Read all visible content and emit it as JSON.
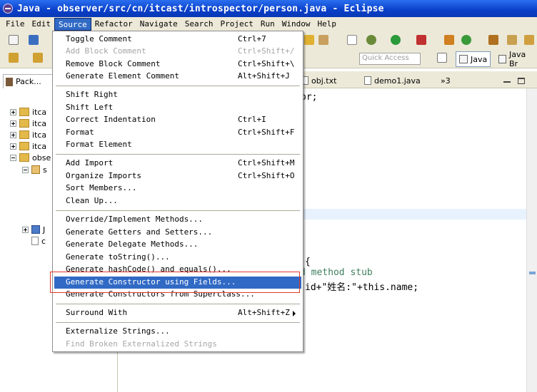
{
  "window": {
    "title": "Java - observer/src/cn/itcast/introspector/person.java - Eclipse"
  },
  "menubar": {
    "items": [
      "File",
      "Edit",
      "Source",
      "Refactor",
      "Navigate",
      "Search",
      "Project",
      "Run",
      "Window",
      "Help"
    ],
    "active": "Source"
  },
  "toolbar": {
    "quick_access_placeholder": "Quick Access",
    "perspectives": [
      "Java",
      "Java Br"
    ]
  },
  "left_panel": {
    "tab_label": "Pack...",
    "tree": [
      {
        "label": "itca",
        "expanded": false
      },
      {
        "label": "itca",
        "expanded": false
      },
      {
        "label": "itca",
        "expanded": false
      },
      {
        "label": "itca",
        "expanded": false
      },
      {
        "label": "obse",
        "expanded": true
      },
      {
        "label": "s",
        "expanded": true
      },
      {
        "label": "J",
        "expanded": false
      },
      {
        "label": "c",
        "expanded": false
      }
    ]
  },
  "editor": {
    "tabs": [
      {
        "label": "obj.txt"
      },
      {
        "label": "demo1.java"
      },
      {
        "label": "»3"
      }
    ],
    "code_lines": [
      "or;",
      "{",
      "d method stub",
      "id+\"姓名:\"+this.name;"
    ]
  },
  "source_menu": {
    "groups": [
      [
        {
          "label": "Toggle Comment",
          "shortcut": "Ctrl+7",
          "enabled": true
        },
        {
          "label": "Add Block Comment",
          "shortcut": "Ctrl+Shift+/",
          "enabled": false
        },
        {
          "label": "Remove Block Comment",
          "shortcut": "Ctrl+Shift+\\",
          "enabled": true
        },
        {
          "label": "Generate Element Comment",
          "shortcut": "Alt+Shift+J",
          "enabled": true
        }
      ],
      [
        {
          "label": "Shift Right",
          "shortcut": "",
          "enabled": true
        },
        {
          "label": "Shift Left",
          "shortcut": "",
          "enabled": true
        },
        {
          "label": "Correct Indentation",
          "shortcut": "Ctrl+I",
          "enabled": true
        },
        {
          "label": "Format",
          "shortcut": "Ctrl+Shift+F",
          "enabled": true
        },
        {
          "label": "Format Element",
          "shortcut": "",
          "enabled": true
        }
      ],
      [
        {
          "label": "Add Import",
          "shortcut": "Ctrl+Shift+M",
          "enabled": true
        },
        {
          "label": "Organize Imports",
          "shortcut": "Ctrl+Shift+O",
          "enabled": true
        },
        {
          "label": "Sort Members...",
          "shortcut": "",
          "enabled": true
        },
        {
          "label": "Clean Up...",
          "shortcut": "",
          "enabled": true
        }
      ],
      [
        {
          "label": "Override/Implement Methods...",
          "shortcut": "",
          "enabled": true
        },
        {
          "label": "Generate Getters and Setters...",
          "shortcut": "",
          "enabled": true
        },
        {
          "label": "Generate Delegate Methods...",
          "shortcut": "",
          "enabled": true
        },
        {
          "label": "Generate toString()...",
          "shortcut": "",
          "enabled": true
        },
        {
          "label": "Generate hashCode() and equals()...",
          "shortcut": "",
          "enabled": true
        },
        {
          "label": "Generate Constructor using Fields...",
          "shortcut": "",
          "enabled": true,
          "selected": true
        },
        {
          "label": "Generate Constructors from Superclass...",
          "shortcut": "",
          "enabled": true
        }
      ],
      [
        {
          "label": "Surround With",
          "shortcut": "Alt+Shift+Z",
          "enabled": true,
          "submenu": true
        }
      ],
      [
        {
          "label": "Externalize Strings...",
          "shortcut": "",
          "enabled": true
        },
        {
          "label": "Find Broken Externalized Strings",
          "shortcut": "",
          "enabled": false
        }
      ]
    ]
  },
  "colors": {
    "selection": "#316ac5",
    "highlight_box": "#e0392b",
    "chrome": "#ece9d8"
  }
}
